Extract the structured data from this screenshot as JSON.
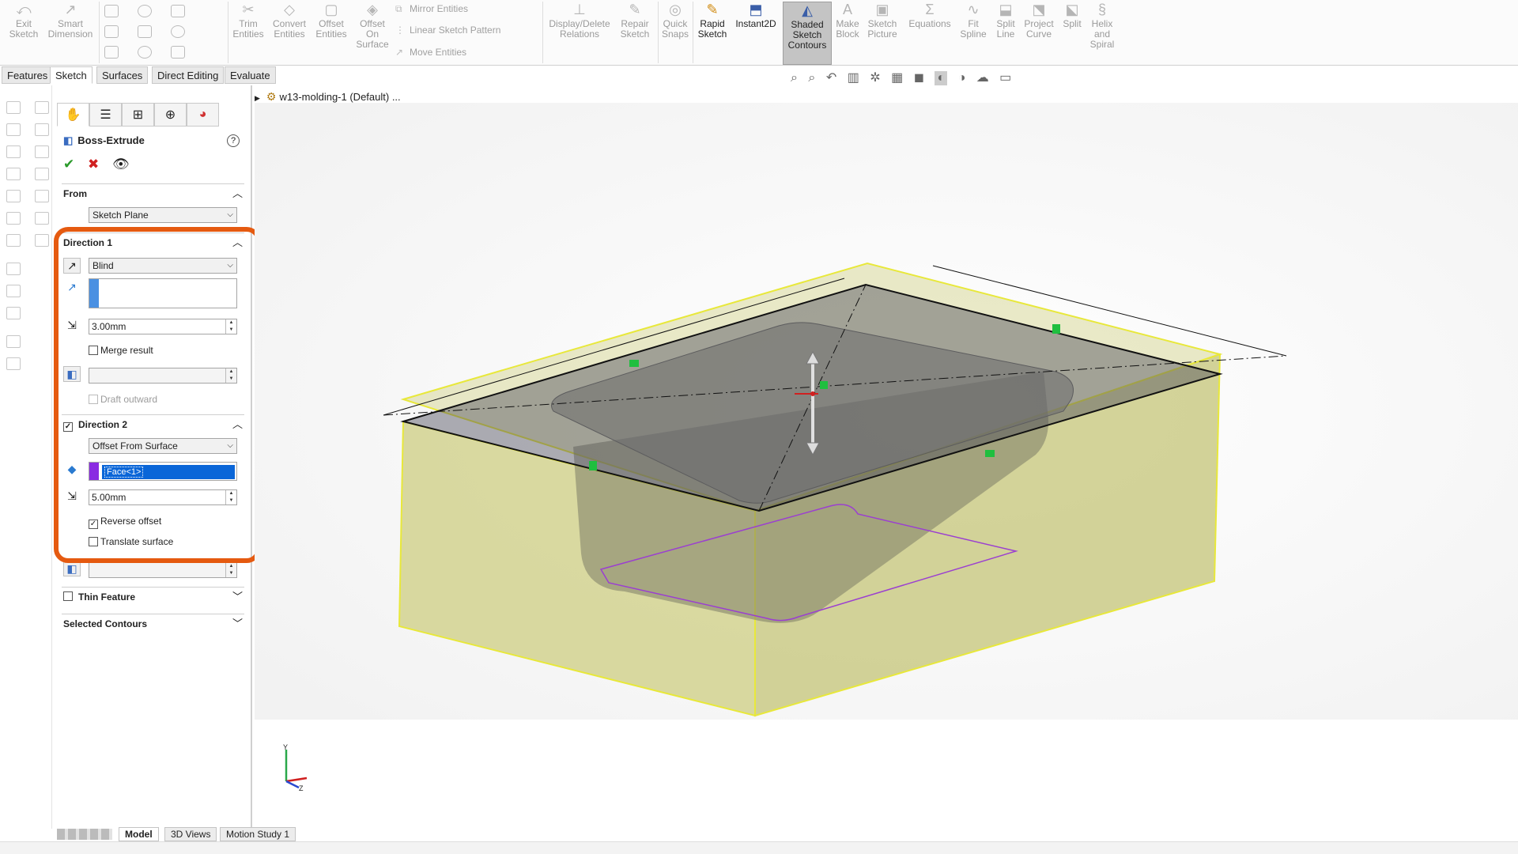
{
  "ribbon": {
    "buttons": [
      {
        "label": "Exit\nSketch",
        "icon": "exit-sketch-icon",
        "active": false
      },
      {
        "label": "Smart\nDimension",
        "icon": "smart-dimension-icon",
        "active": false
      },
      {
        "label": "Trim\nEntities",
        "icon": "trim-icon",
        "active": false
      },
      {
        "label": "Convert\nEntities",
        "icon": "convert-icon",
        "active": false
      },
      {
        "label": "Offset\nEntities",
        "icon": "offset-icon",
        "active": false
      },
      {
        "label": "Offset\nOn\nSurface",
        "icon": "offset-surface-icon",
        "active": false
      },
      {
        "label": "Display/Delete\nRelations",
        "icon": "relations-icon",
        "active": false
      },
      {
        "label": "Repair\nSketch",
        "icon": "repair-icon",
        "active": false
      },
      {
        "label": "Quick\nSnaps",
        "icon": "snaps-icon",
        "active": false
      },
      {
        "label": "Rapid\nSketch",
        "icon": "rapid-sketch-icon",
        "active": true
      },
      {
        "label": "Instant2D",
        "icon": "instant2d-icon",
        "active": true
      },
      {
        "label": "Shaded\nSketch\nContours",
        "icon": "shaded-contours-icon",
        "active": true
      },
      {
        "label": "Make\nBlock",
        "icon": "block-icon",
        "active": false
      },
      {
        "label": "Sketch\nPicture",
        "icon": "picture-icon",
        "active": false
      },
      {
        "label": "Equations",
        "icon": "equations-icon",
        "active": false
      },
      {
        "label": "Fit\nSpline",
        "icon": "spline-icon",
        "active": false
      },
      {
        "label": "Split\nLine",
        "icon": "split-line-icon",
        "active": false
      },
      {
        "label": "Project\nCurve",
        "icon": "project-curve-icon",
        "active": false
      },
      {
        "label": "Split",
        "icon": "split-icon",
        "active": false
      },
      {
        "label": "Helix\nand\nSpiral",
        "icon": "helix-icon",
        "active": false
      }
    ],
    "small_commands": [
      "Mirror Entities",
      "Linear Sketch Pattern",
      "Move Entities"
    ]
  },
  "command_tabs": [
    "Features",
    "Sketch",
    "Surfaces",
    "Direct Editing",
    "Evaluate"
  ],
  "active_command_tab": "Sketch",
  "feature": {
    "title": "Boss-Extrude",
    "from": {
      "header": "From",
      "value": "Sketch Plane"
    },
    "direction1": {
      "header": "Direction 1",
      "end_condition": "Blind",
      "depth": "3.00mm",
      "merge_result": "Merge result",
      "draft_outward": "Draft outward"
    },
    "direction2": {
      "header": "Direction 2",
      "end_condition": "Offset From Surface",
      "selected_face": "Face<1>",
      "offset": "5.00mm",
      "reverse_offset": "Reverse offset",
      "translate_surface": "Translate surface"
    },
    "thin_feature": "Thin Feature",
    "selected_contours": "Selected Contours"
  },
  "tree": {
    "root": "w13-molding-1 (Default) ..."
  },
  "bottom_tabs": [
    "Model",
    "3D Views",
    "Motion Study 1"
  ],
  "active_bottom_tab": "Model",
  "colors": {
    "highlight": "#e55a10",
    "selection": "#0a66d8",
    "body": "#e6e69a"
  }
}
